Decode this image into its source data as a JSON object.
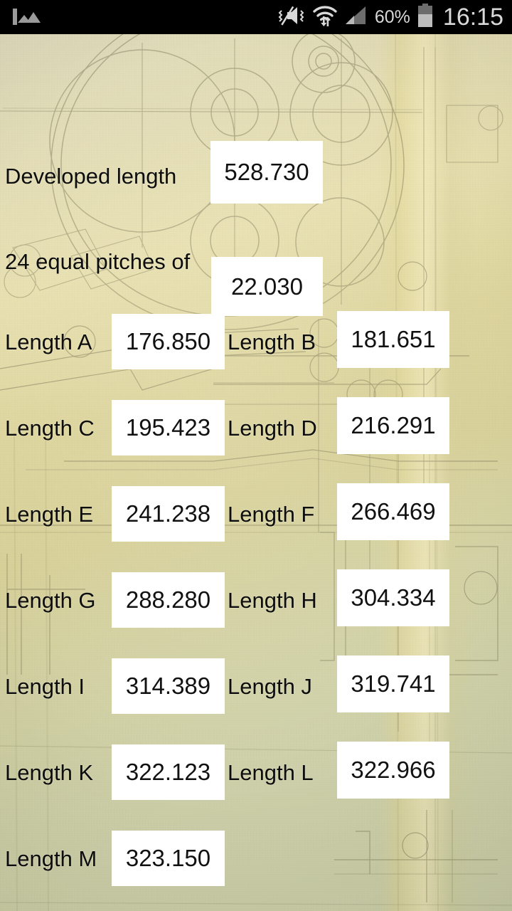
{
  "status_bar": {
    "notification_icon": "photo-icon",
    "silent_icon": "volume-mute-vibrate-icon",
    "wifi_icon": "wifi-data-transfer-icon",
    "signal_icon": "cellular-signal-icon",
    "battery_percent": "60%",
    "battery_icon": "battery-icon",
    "clock": "16:15",
    "bar_color": "#000000",
    "icon_color": "#d8d8d8"
  },
  "theme": {
    "label_color": "#0d0d0d",
    "field_background": "#ffffff",
    "field_text_color": "#111111",
    "wallpaper": "engineering-blueprint-photo"
  },
  "form": {
    "summary": [
      {
        "label": "Developed length",
        "value": "528.730"
      },
      {
        "label": "24 equal pitches of",
        "value": "22.030"
      }
    ],
    "lengths": [
      {
        "label": "Length A",
        "value": "176.850"
      },
      {
        "label": "Length B",
        "value": "181.651"
      },
      {
        "label": "Length C",
        "value": "195.423"
      },
      {
        "label": "Length D",
        "value": "216.291"
      },
      {
        "label": "Length E",
        "value": "241.238"
      },
      {
        "label": "Length F",
        "value": "266.469"
      },
      {
        "label": "Length G",
        "value": "288.280"
      },
      {
        "label": "Length H",
        "value": "304.334"
      },
      {
        "label": "Length I",
        "value": "314.389"
      },
      {
        "label": "Length J",
        "value": "319.741"
      },
      {
        "label": "Length K",
        "value": "322.123"
      },
      {
        "label": "Length L",
        "value": "322.966"
      },
      {
        "label": "Length M",
        "value": "323.150"
      }
    ]
  }
}
